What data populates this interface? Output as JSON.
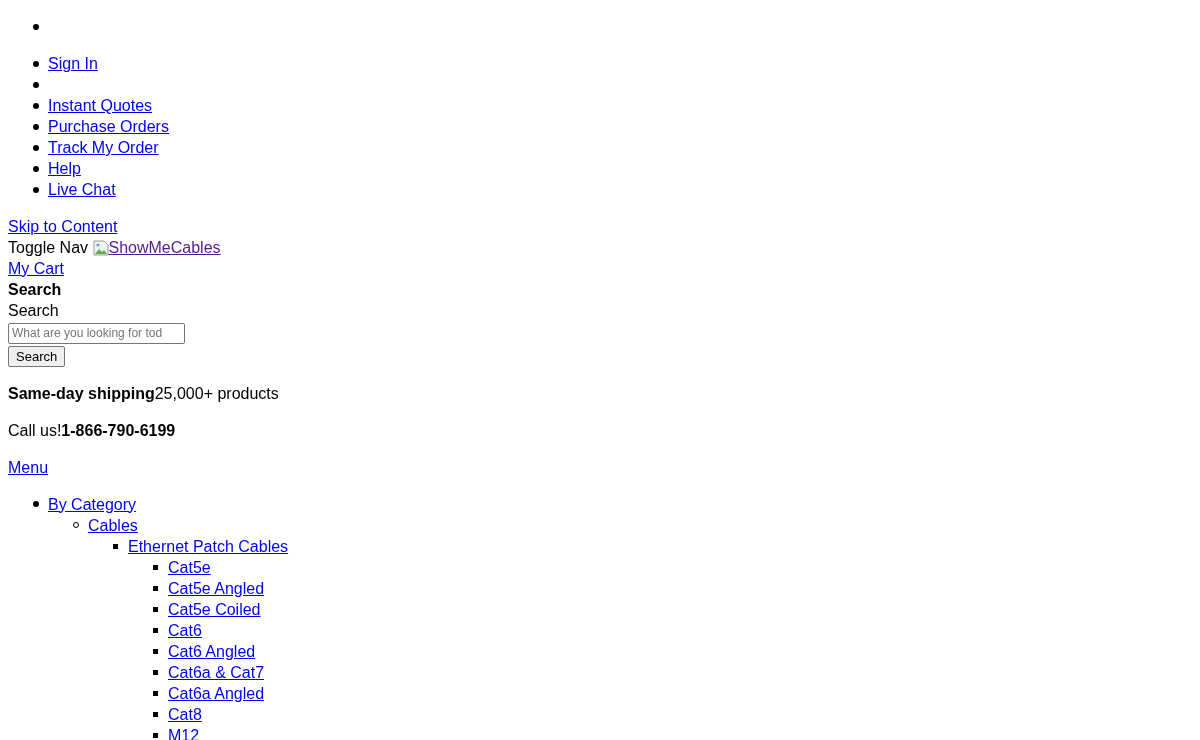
{
  "top_menu": [
    {
      "kind": "blank"
    },
    {
      "kind": "link",
      "label": "Sign In"
    },
    {
      "kind": "blank"
    },
    {
      "kind": "link",
      "label": "Instant Quotes"
    },
    {
      "kind": "link",
      "label": "Purchase Orders"
    },
    {
      "kind": "link",
      "label": "Track My Order"
    },
    {
      "kind": "link",
      "label": "Help"
    },
    {
      "kind": "link",
      "label": "Live Chat"
    }
  ],
  "skip_link": "Skip to Content",
  "toggle_nav": "Toggle Nav",
  "logo": {
    "alt_text": "ShowMeCables",
    "visited": true
  },
  "cart_link": "My Cart",
  "search": {
    "heading": "Search",
    "label": "Search",
    "placeholder": "What are you looking for tod",
    "button": "Search"
  },
  "shipping": "**Same-day shipping**25,000+ products",
  "call": "Call us!**1-866-790-6199**",
  "menu_link": "Menu",
  "nav": [
    {
      "label": "By Category",
      "children": [
        {
          "label": "Cables",
          "children": [
            {
              "label": "Ethernet Patch Cables",
              "children": [
                {
                  "label": "Cat5e"
                },
                {
                  "label": "Cat5e Angled"
                },
                {
                  "label": "Cat5e Coiled"
                },
                {
                  "label": "Cat6"
                },
                {
                  "label": "Cat6 Angled"
                },
                {
                  "label": "Cat6a & Cat7"
                },
                {
                  "label": "Cat6a Angled"
                },
                {
                  "label": "Cat8"
                },
                {
                  "label": "M12"
                }
              ]
            }
          ]
        }
      ]
    }
  ]
}
